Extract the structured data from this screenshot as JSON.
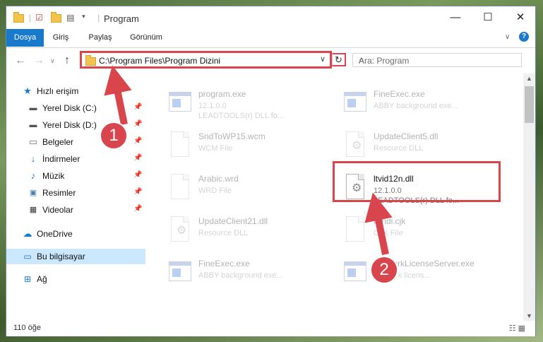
{
  "window": {
    "title": "Program"
  },
  "ribbon": {
    "tabs": [
      "Dosya",
      "Giriş",
      "Paylaş",
      "Görünüm"
    ]
  },
  "address": {
    "path": "C:\\Program Files\\Program Dizini",
    "search_placeholder": "Ara: Program"
  },
  "sidebar": {
    "items": [
      {
        "label": "Hızlı erişim",
        "icon": "star-icon"
      },
      {
        "label": "Yerel Disk (C:)",
        "icon": "drive-icon"
      },
      {
        "label": "Yerel Disk (D:)",
        "icon": "drive-icon"
      },
      {
        "label": "Belgeler",
        "icon": "documents-icon"
      },
      {
        "label": "İndirmeler",
        "icon": "download-icon"
      },
      {
        "label": "Müzik",
        "icon": "music-icon"
      },
      {
        "label": "Resimler",
        "icon": "pictures-icon"
      },
      {
        "label": "Videolar",
        "icon": "video-icon"
      },
      {
        "label": "OneDrive",
        "icon": "cloud-icon"
      },
      {
        "label": "Bu bilgisayar",
        "icon": "computer-icon"
      },
      {
        "label": "Ağ",
        "icon": "network-icon"
      }
    ]
  },
  "files": [
    {
      "name": "program.exe",
      "line2": "12.1.0.0",
      "line3": "LEADTOOLS(r) DLL fo...",
      "type": "exe-icon"
    },
    {
      "name": "FineExec.exe",
      "line2": "ABBY background exe...",
      "line3": "",
      "type": "exe-icon"
    },
    {
      "name": "SndToWP15.wcm",
      "line2": "WCM File",
      "line3": "",
      "type": "document-icon"
    },
    {
      "name": "UpdateClient5.dll",
      "line2": "Resource DLL",
      "line3": "",
      "type": "dll-icon"
    },
    {
      "name": "Arabic.wrd",
      "line2": "WRD File",
      "line3": "",
      "type": "document-icon"
    },
    {
      "name": "ltvid12n.dll",
      "line2": "12.1.0.0",
      "line3": "LEADTOOLS(r) DLL fo...",
      "type": "dll-icon"
    },
    {
      "name": "UpdateClient21.dll",
      "line2": "Resource DLL",
      "line3": "",
      "type": "dll-icon"
    },
    {
      "name": "Hindi.cjk",
      "line2": "CJK File",
      "line3": "",
      "type": "document-icon"
    },
    {
      "name": "FineExec.exe",
      "line2": "ABBY background exe...",
      "line3": "",
      "type": "exe-icon"
    },
    {
      "name": "NetworkLicenseServer.exe",
      "line2": "Network licens...",
      "line3": "",
      "type": "exe-icon"
    }
  ],
  "status": {
    "count": "110 öğe"
  },
  "annotations": {
    "step1": "1",
    "step2": "2",
    "color": "#d8454c"
  }
}
